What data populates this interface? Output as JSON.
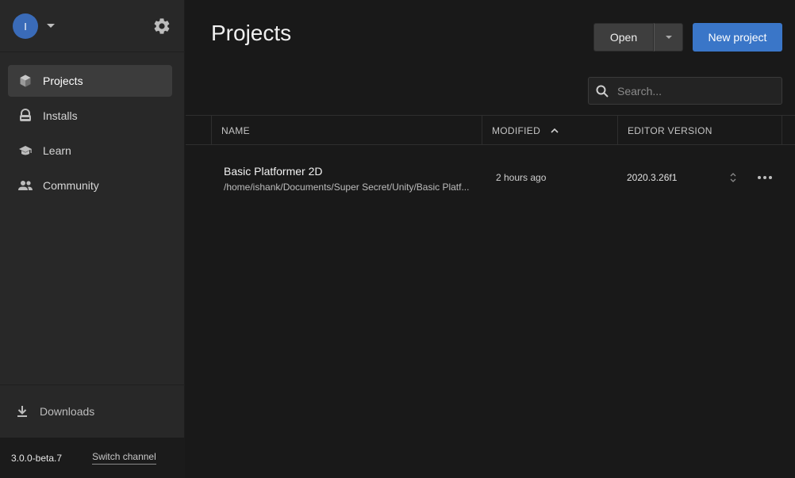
{
  "user": {
    "avatar_initial": "I"
  },
  "sidebar": {
    "items": [
      {
        "label": "Projects",
        "icon": "cube-icon",
        "active": true
      },
      {
        "label": "Installs",
        "icon": "lock-icon",
        "active": false
      },
      {
        "label": "Learn",
        "icon": "graduation-cap-icon",
        "active": false
      },
      {
        "label": "Community",
        "icon": "people-icon",
        "active": false
      }
    ],
    "downloads_label": "Downloads",
    "version": "3.0.0-beta.7",
    "switch_channel_label": "Switch channel"
  },
  "main": {
    "title": "Projects",
    "open_label": "Open",
    "new_project_label": "New project",
    "search": {
      "placeholder": "Search..."
    }
  },
  "table": {
    "columns": [
      "NAME",
      "MODIFIED",
      "EDITOR VERSION"
    ],
    "sort_column": "MODIFIED",
    "rows": [
      {
        "name": "Basic Platformer 2D",
        "path": "/home/ishank/Documents/Super Secret/Unity/Basic Platf...",
        "modified": "2 hours ago",
        "editor_version": "2020.3.26f1"
      }
    ]
  },
  "colors": {
    "accent": "#3a76c8",
    "avatar": "#3a6bb8",
    "background": "#191919",
    "sidebar": "#282828"
  }
}
